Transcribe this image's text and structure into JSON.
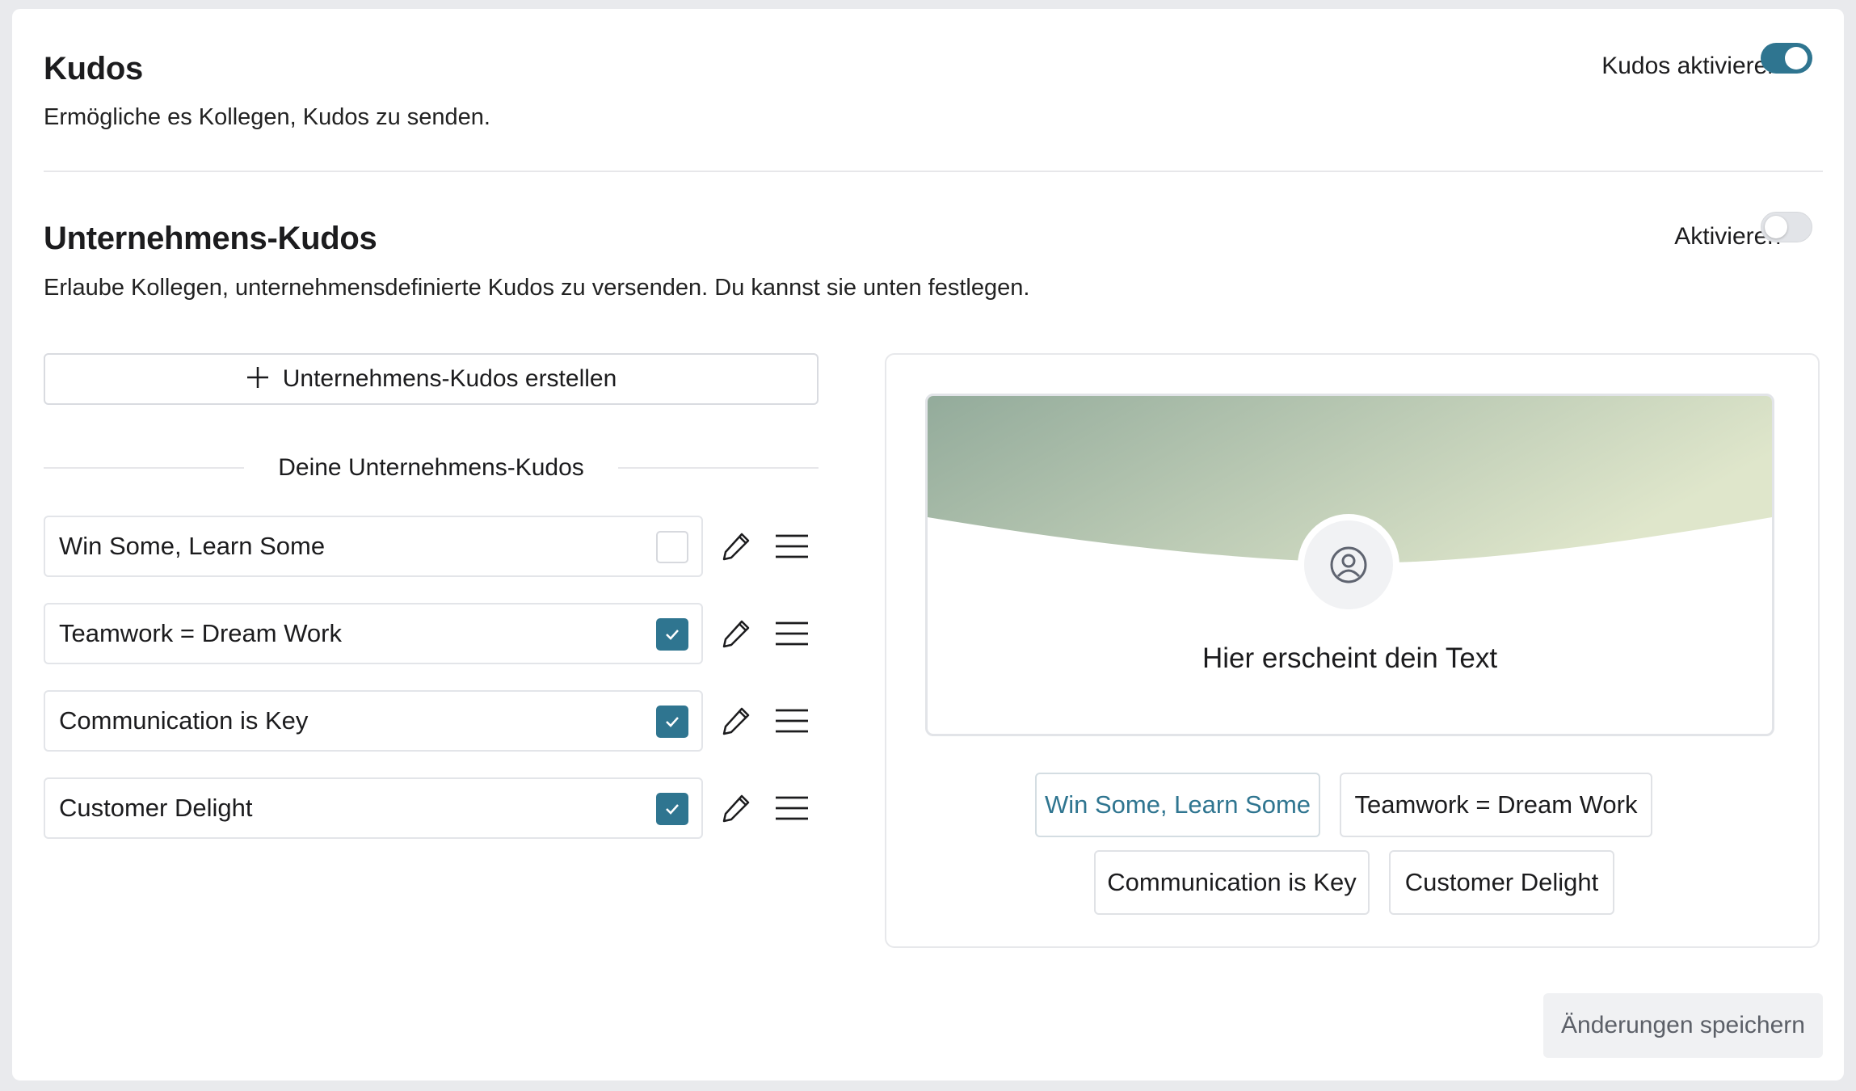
{
  "kudos": {
    "title": "Kudos",
    "description": "Ermögliche es Kollegen, Kudos zu senden.",
    "toggle_label": "Kudos aktivieren",
    "enabled": true
  },
  "company_kudos": {
    "title": "Unternehmens-Kudos",
    "description": "Erlaube Kollegen, unternehmensdefinierte Kudos zu versenden. Du kannst sie unten festlegen.",
    "toggle_label": "Aktivieren",
    "enabled": false,
    "create_button_label": "Unternehmens-Kudos erstellen",
    "list_heading": "Deine Unternehmens-Kudos",
    "items": [
      {
        "label": "Win Some, Learn Some",
        "checked": false
      },
      {
        "label": "Teamwork = Dream Work",
        "checked": true
      },
      {
        "label": "Communication is Key",
        "checked": true
      },
      {
        "label": "Customer Delight",
        "checked": true
      }
    ]
  },
  "preview": {
    "placeholder_text": "Hier erscheint dein Text",
    "chips": [
      {
        "label": "Win Some, Learn Some",
        "selected": true
      },
      {
        "label": "Teamwork = Dream Work",
        "selected": false
      },
      {
        "label": "Communication is Key",
        "selected": false
      },
      {
        "label": "Customer Delight",
        "selected": false
      }
    ]
  },
  "footer": {
    "save_label": "Änderungen speichern"
  },
  "colors": {
    "accent": "#2f7590",
    "banner_start": "#93ab9b",
    "banner_end": "#dfe6cb"
  }
}
